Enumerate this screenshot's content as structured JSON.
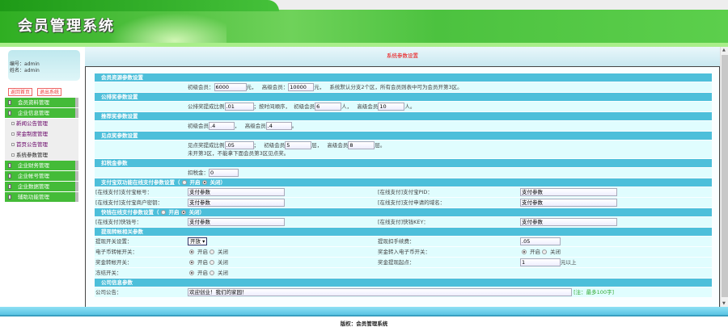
{
  "header": {
    "title": "会员管理系统"
  },
  "user": {
    "id_label": "编号：",
    "id": "admin",
    "name_label": "姓名：",
    "name": "admin"
  },
  "buttons": {
    "home": "返回首页",
    "logout": "退出系统"
  },
  "menu": [
    {
      "label": "会员资料管理"
    },
    {
      "label": "企业信息管理",
      "children": [
        "新闻公告管理",
        "奖金制度管理",
        "首页公告管理",
        "系统参数管理"
      ]
    },
    {
      "label": "企业财务管理"
    },
    {
      "label": "企业帐号管理"
    },
    {
      "label": "企业数据管理"
    },
    {
      "label": "辅助功能管理"
    }
  ],
  "page_title": "系统参数设置",
  "s1": {
    "title": "会员资源参数设置",
    "l1": "初级会员：",
    "v1": "6000",
    "u1": "元，",
    "l2": "高级会员：",
    "v2": "10000",
    "u2": "元，",
    "note": "系统默认分支2个区，所有会员则表中可为会员开第3区。"
  },
  "s2": {
    "title": "公排奖参数设置",
    "l1": "公排奖提成比例",
    "v1": ".01",
    "t1": "；按时间顺序，",
    "l2": "初级会员",
    "v2": "6",
    "u2": "人，",
    "l3": "高级会员",
    "v3": "10",
    "u3": "人。"
  },
  "s3": {
    "title": "推荐奖参数设置",
    "l1": "初级会员",
    "v1": ".4",
    "t1": "，",
    "l2": "高级会员",
    "v2": ".4",
    "t2": "。"
  },
  "s4": {
    "title": "见点奖参数设置",
    "l1": "见点奖提成比例",
    "v1": ".05",
    "t1": "；",
    "l2": "初级会员",
    "v2": "5",
    "u2": "层，",
    "l3": "高级会员",
    "v3": "8",
    "u3": "层。",
    "note": "未开第3区，不能拿下面会员第3区见点奖。"
  },
  "s5": {
    "title": "扣税金参数",
    "l1": "扣税金：",
    "v1": "0"
  },
  "s6": {
    "title": "支付宝双功能在线支付参数设置（",
    "on": "开启",
    "off": "关闭",
    "close": "）",
    "rows": [
      [
        "[在线支付]支付宝帐号：",
        "支付参数",
        "[在线支付]支付宝PID：",
        "支付参数"
      ],
      [
        "[在线支付]支付宝商户密钥：",
        "支付参数",
        "[在线支付]支付申请的域名：",
        "支付参数"
      ]
    ]
  },
  "s7": {
    "title": "快钱在线支付参数设置（",
    "on": "开启",
    "off": "关闭",
    "close": "）",
    "rows": [
      [
        "[在线支付]快钱号：",
        "支付参数",
        "[在线支付]快钱KEY：",
        "支付参数"
      ]
    ]
  },
  "s8": {
    "title": "提现转帐相关参数",
    "withdraw_label": "提现开关设置：",
    "withdraw_value": "开放",
    "fee_label": "提现扣手续费：",
    "fee_value": ".05",
    "ecoin_label": "电子币转帐开关：",
    "bonus_to_ecoin_label": "奖金转入电子币开关：",
    "bonus_transfer_label": "奖金转帐开关：",
    "min_label": "奖金提现起点：",
    "min_value": "1",
    "min_unit": "元以上",
    "freeze_label": "冻结开关：",
    "on": "开启",
    "off": "关闭"
  },
  "s9": {
    "title": "公司信息参数",
    "l1": "公司公告：",
    "v1": "欢迎创业！我们的家园！",
    "note": "[注：最多100字]"
  },
  "footer": "版权：会员管理系统"
}
